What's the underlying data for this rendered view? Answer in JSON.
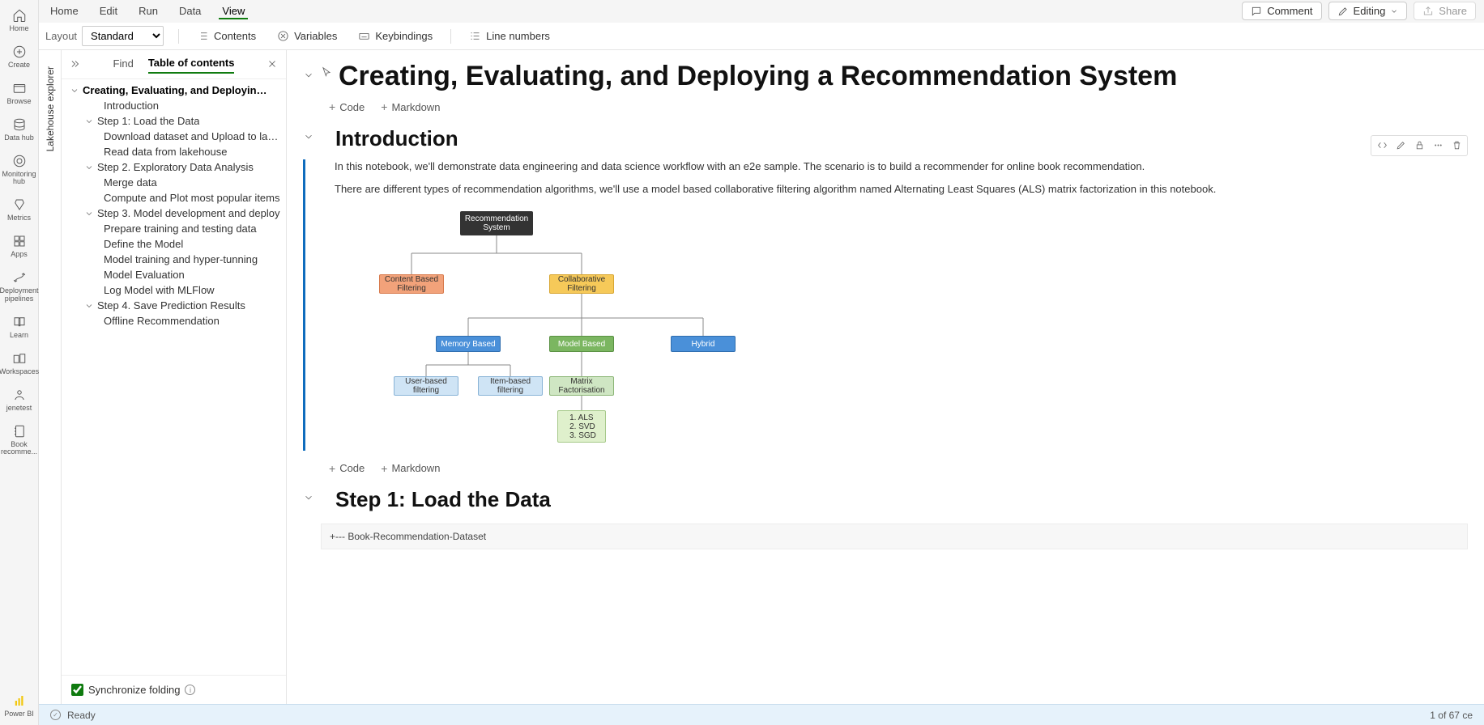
{
  "nav_rail": [
    {
      "icon": "home",
      "label": "Home"
    },
    {
      "icon": "plus-circle",
      "label": "Create"
    },
    {
      "icon": "folder",
      "label": "Browse"
    },
    {
      "icon": "grid",
      "label": "Data hub"
    },
    {
      "icon": "target",
      "label": "Monitoring hub"
    },
    {
      "icon": "trophy",
      "label": "Metrics"
    },
    {
      "icon": "apps",
      "label": "Apps"
    },
    {
      "icon": "rocket",
      "label": "Deployment pipelines"
    },
    {
      "icon": "book",
      "label": "Learn"
    },
    {
      "icon": "workspaces",
      "label": "Workspaces"
    },
    {
      "icon": "user",
      "label": "jenetest"
    },
    {
      "icon": "notebook",
      "label": "Book recomme..."
    },
    {
      "icon": "powerbi",
      "label": "Power BI"
    }
  ],
  "menu": {
    "items": [
      "Home",
      "Edit",
      "Run",
      "Data",
      "View"
    ],
    "active": "View"
  },
  "header": {
    "comment": "Comment",
    "editing": "Editing",
    "share": "Share"
  },
  "toolbar": {
    "layout_label": "Layout",
    "layout_value": "Standard",
    "contents": "Contents",
    "variables": "Variables",
    "keybindings": "Keybindings",
    "line_numbers": "Line numbers"
  },
  "lakehouse_tab": "Lakehouse explorer",
  "sidebar": {
    "find": "Find",
    "toc": "Table of contents",
    "root": "Creating, Evaluating, and Deployin…",
    "items": [
      {
        "l": 2,
        "t": "Introduction"
      },
      {
        "l": 1,
        "t": "Step 1: Load the Data"
      },
      {
        "l": 2,
        "t": "Download dataset and Upload to lakeh..."
      },
      {
        "l": 2,
        "t": "Read data from lakehouse"
      },
      {
        "l": 1,
        "t": "Step 2. Exploratory Data Analysis"
      },
      {
        "l": 2,
        "t": "Merge data"
      },
      {
        "l": 2,
        "t": "Compute and Plot most popular items"
      },
      {
        "l": 1,
        "t": "Step 3. Model development and deploy"
      },
      {
        "l": 2,
        "t": "Prepare training and testing data"
      },
      {
        "l": 2,
        "t": "Define the Model"
      },
      {
        "l": 2,
        "t": "Model training and hyper-tunning"
      },
      {
        "l": 2,
        "t": "Model Evaluation"
      },
      {
        "l": 2,
        "t": "Log Model with MLFlow"
      },
      {
        "l": 1,
        "t": "Step 4. Save Prediction Results"
      },
      {
        "l": 2,
        "t": "Offline Recommendation"
      }
    ],
    "sync": "Synchronize folding"
  },
  "notebook": {
    "title": "Creating, Evaluating, and Deploying a Recommendation System",
    "code": "Code",
    "markdown": "Markdown",
    "intro": "Introduction",
    "p1": "In this notebook, we'll demonstrate data engineering and data science workflow with an e2e sample. The scenario is to build a recommender for online book recommendation.",
    "p2": "There are different types of recommendation algorithms, we'll use a model based collaborative filtering algorithm named Alternating Least Squares (ALS) matrix factorization in this notebook.",
    "step1": "Step 1: Load the Data",
    "code_line": "+--- Book-Recommendation-Dataset"
  },
  "diagram": {
    "root": "Recommendation System",
    "cbf": "Content Based Filtering",
    "colf": "Collaborative Filtering",
    "mem": "Memory Based",
    "model": "Model Based",
    "hybrid": "Hybrid",
    "user": "User-based filtering",
    "item": "Item-based filtering",
    "matrix": "Matrix Factorisation",
    "list": "1. ALS\n2. SVD\n3. SGD"
  },
  "status": {
    "ready": "Ready",
    "cells": "1 of 67 ce"
  }
}
